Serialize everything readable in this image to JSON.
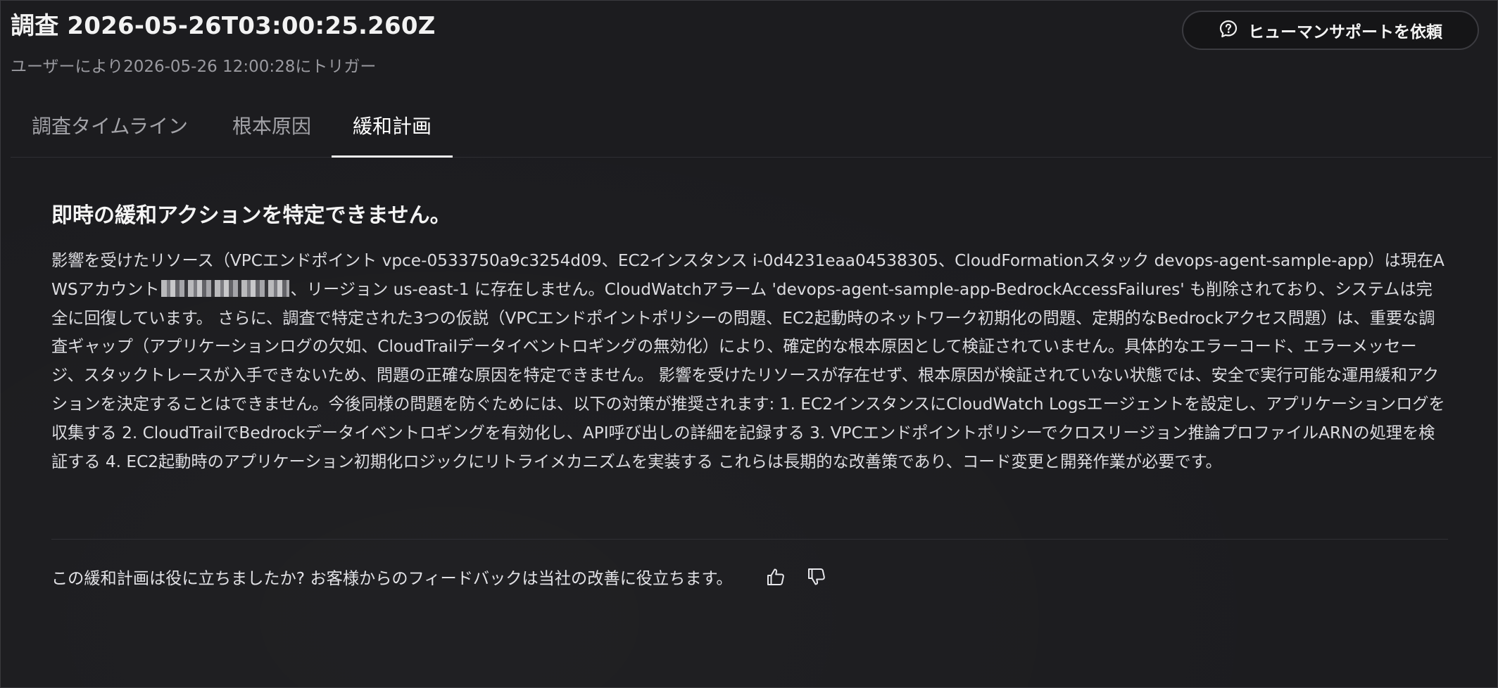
{
  "header": {
    "title": "調査 2026-05-26T03:00:25.260Z",
    "subtitle": "ユーザーにより2026-05-26 12:00:28にトリガー",
    "help_button_label": "ヒューマンサポートを依頼",
    "help_button_icon": "question-bubble-icon"
  },
  "tabs": [
    {
      "label": "調査タイムライン",
      "active": false
    },
    {
      "label": "根本原因",
      "active": false
    },
    {
      "label": "緩和計画",
      "active": true
    }
  ],
  "plan": {
    "title": "即時の緩和アクションを特定できません。",
    "body_part1": "影響を受けたリソース（VPCエンドポイント vpce-0533750a9c3254d09、EC2インスタンス i-0d4231eaa04538305、CloudFormationスタック devops-agent-sample-app）は現在AWSアカウント",
    "body_part2": "、リージョン us-east-1 に存在しません。CloudWatchアラーム 'devops-agent-sample-app-BedrockAccessFailures' も削除されており、システムは完全に回復しています。 さらに、調査で特定された3つの仮説（VPCエンドポイントポリシーの問題、EC2起動時のネットワーク初期化の問題、定期的なBedrockアクセス問題）は、重要な調査ギャップ（アプリケーションログの欠如、CloudTrailデータイベントロギングの無効化）により、確定的な根本原因として検証されていません。具体的なエラーコード、エラーメッセージ、スタックトレースが入手できないため、問題の正確な原因を特定できません。 影響を受けたリソースが存在せず、根本原因が検証されていない状態では、安全で実行可能な運用緩和アクションを決定することはできません。今後同様の問題を防ぐためには、以下の対策が推奨されます: 1. EC2インスタンスにCloudWatch Logsエージェントを設定し、アプリケーションログを収集する 2. CloudTrailでBedrockデータイベントロギングを有効化し、API呼び出しの詳細を記録する 3. VPCエンドポイントポリシーでクロスリージョン推論プロファイルARNの処理を検証する 4. EC2起動時のアプリケーション初期化ロジックにリトライメカニズムを実装する これらは長期的な改善策であり、コード変更と開発作業が必要です。"
  },
  "feedback": {
    "prompt": "この緩和計画は役に立ちましたか? お客様からのフィードバックは当社の改善に役立ちます。",
    "thumbs_up_icon": "thumbs-up-icon",
    "thumbs_down_icon": "thumbs-down-icon"
  },
  "colors": {
    "background": "#1c1c1f",
    "text_primary": "#f2f2f2",
    "text_secondary": "#9a9aa0",
    "divider": "#303035"
  }
}
